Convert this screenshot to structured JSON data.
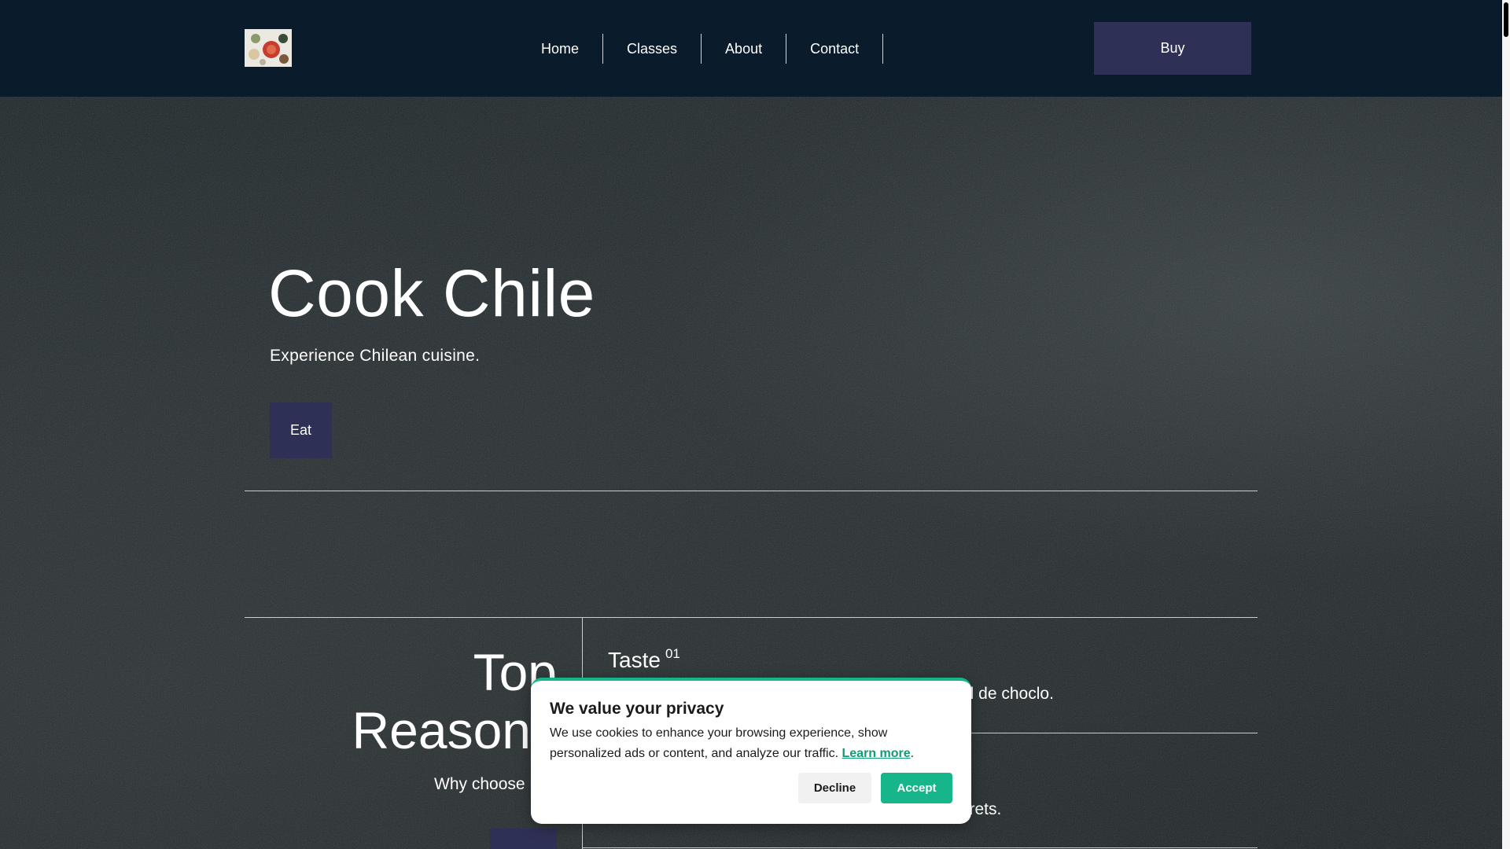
{
  "header": {
    "logo_alt": "",
    "nav": [
      {
        "label": "Home"
      },
      {
        "label": "Classes"
      },
      {
        "label": "About"
      },
      {
        "label": "Contact"
      }
    ],
    "buy_label": "Buy"
  },
  "hero": {
    "title": "Cook Chile",
    "subtitle": "Experience Chilean cuisine.",
    "cta_label": "Eat"
  },
  "reasons": {
    "title_line1": "Top",
    "title_line2": "Reasons",
    "subtitle": "Why choose",
    "items": [
      {
        "title": "Taste",
        "number": "01",
        "text_visible": "el de choclo."
      },
      {
        "title": "",
        "number": "",
        "text_visible": "crets."
      }
    ]
  },
  "cookie": {
    "title": "We value your privacy",
    "body": "We use cookies to enhance your browsing experience, show personalized ads or content, and analyze our traffic.",
    "learn_more": "Learn more",
    "period": ".",
    "decline_label": "Decline",
    "accept_label": "Accept"
  },
  "colors": {
    "header_bg": "#0a1b2b",
    "button_bg": "#2f3056",
    "accent": "#17b68a"
  }
}
